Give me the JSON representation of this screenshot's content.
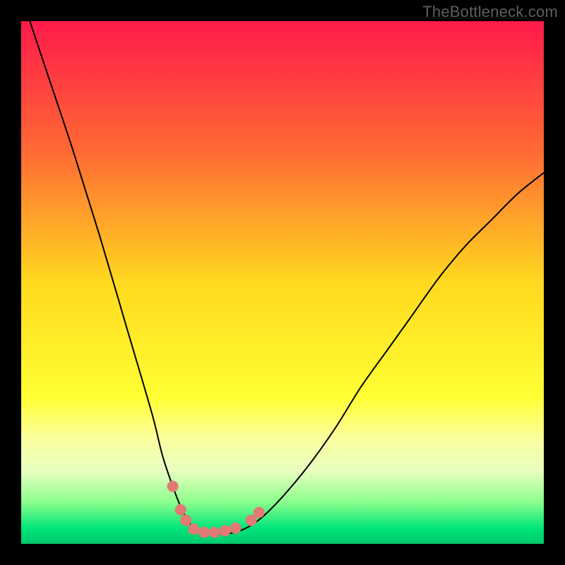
{
  "watermark": "TheBottleneck.com",
  "chart_data": {
    "type": "line",
    "title": "",
    "xlabel": "",
    "ylabel": "",
    "xlim": [
      0,
      100
    ],
    "ylim": [
      0,
      100
    ],
    "legend": false,
    "grid": false,
    "background_gradient": {
      "stops": [
        {
          "offset": 0.0,
          "color": "#ff1a4b"
        },
        {
          "offset": 0.25,
          "color": "#ff6a34"
        },
        {
          "offset": 0.5,
          "color": "#ffd91f"
        },
        {
          "offset": 0.72,
          "color": "#ffff33"
        },
        {
          "offset": 0.8,
          "color": "#fbffa0"
        },
        {
          "offset": 0.86,
          "color": "#e8ffc0"
        },
        {
          "offset": 0.92,
          "color": "#8cff8c"
        },
        {
          "offset": 0.97,
          "color": "#00e57a"
        },
        {
          "offset": 1.0,
          "color": "#00c96e"
        }
      ]
    },
    "series": [
      {
        "name": "bottleneck-curve",
        "color": "#000000",
        "x": [
          0,
          5,
          10,
          15,
          20,
          25,
          27,
          29,
          31,
          33,
          35,
          37,
          40,
          43,
          46,
          50,
          55,
          60,
          65,
          70,
          75,
          80,
          85,
          90,
          95,
          100
        ],
        "y": [
          105,
          90,
          75,
          59,
          42,
          25,
          17,
          11,
          6,
          3,
          2,
          2,
          2,
          3,
          5,
          9,
          15,
          22,
          30,
          37,
          44,
          51,
          57,
          62,
          67,
          71
        ]
      }
    ],
    "markers": {
      "name": "highlight-points",
      "color": "#e17a74",
      "radius_px": 8,
      "points": [
        {
          "x": 29.0,
          "y": 11.0
        },
        {
          "x": 30.5,
          "y": 6.5
        },
        {
          "x": 31.5,
          "y": 4.5
        },
        {
          "x": 33.0,
          "y": 2.8
        },
        {
          "x": 35.0,
          "y": 2.2
        },
        {
          "x": 37.0,
          "y": 2.2
        },
        {
          "x": 39.0,
          "y": 2.5
        },
        {
          "x": 41.0,
          "y": 3.0
        },
        {
          "x": 44.0,
          "y": 4.5
        },
        {
          "x": 45.5,
          "y": 6.0
        }
      ]
    }
  }
}
